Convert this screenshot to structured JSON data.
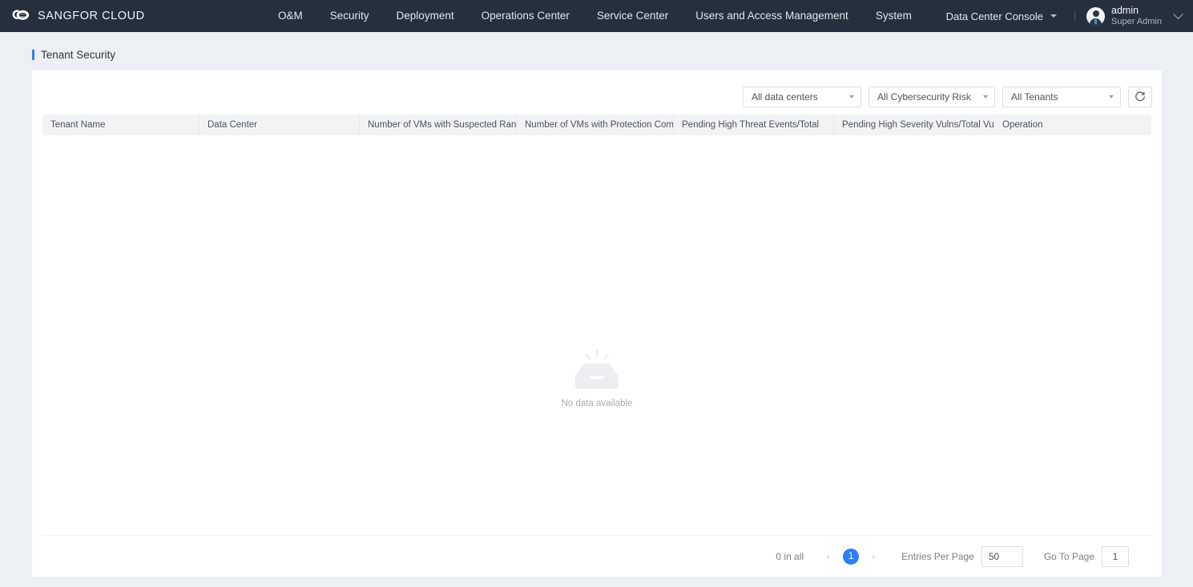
{
  "header": {
    "brand": "SANGFOR CLOUD",
    "logo_icon": "cloud-logo-icon",
    "menu": [
      {
        "label": "O&M"
      },
      {
        "label": "Security"
      },
      {
        "label": "Deployment"
      },
      {
        "label": "Operations Center"
      },
      {
        "label": "Service Center"
      },
      {
        "label": "Users and Access Management"
      },
      {
        "label": "System"
      }
    ],
    "console_switcher": "Data Center Console",
    "user": {
      "name": "admin",
      "role": "Super Admin"
    }
  },
  "page": {
    "title": "Tenant Security",
    "accent_color": "#2f7fe8"
  },
  "filters": {
    "data_center": "All data centers",
    "risk": "All Cybersecurity Risk",
    "tenant": "All Tenants",
    "refresh_icon": "refresh-icon"
  },
  "table": {
    "columns": [
      "Tenant Name",
      "Data Center",
      "Number of VMs with Suspected Ransomw...",
      "Number of VMs with Protection Compromi...",
      "Pending High Threat Events/Total",
      "Pending High Severity Vulns/Total Vulns",
      "Operation"
    ],
    "rows": [],
    "empty_text": "No data available",
    "empty_icon": "empty-inbox-icon"
  },
  "pagination": {
    "total_text": "0 in all",
    "prev_icon": "chevron-left-icon",
    "next_icon": "chevron-right-icon",
    "current_page": "1",
    "entries_per_page_label": "Entries Per Page",
    "entries_per_page_value": "50",
    "go_to_page_label": "Go To Page",
    "go_to_page_value": "1"
  }
}
